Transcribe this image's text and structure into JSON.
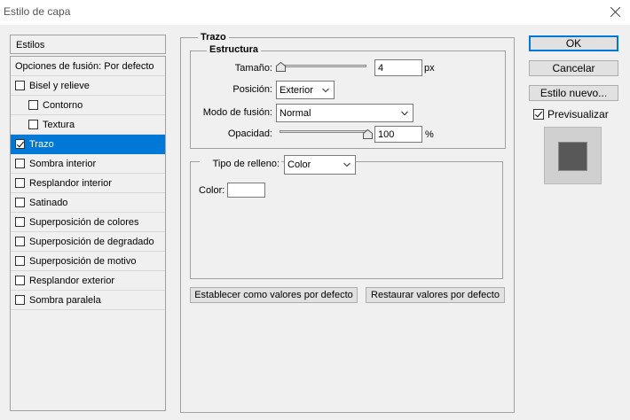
{
  "window": {
    "title": "Estilo de capa"
  },
  "sidebar": {
    "header": "Estilos",
    "items": [
      {
        "label": "Opciones de fusión: Por defecto",
        "checkbox": false,
        "checked": false,
        "indent": 0,
        "selected": false
      },
      {
        "label": "Bisel y relieve",
        "checkbox": true,
        "checked": false,
        "indent": 0,
        "selected": false
      },
      {
        "label": "Contorno",
        "checkbox": true,
        "checked": false,
        "indent": 1,
        "selected": false
      },
      {
        "label": "Textura",
        "checkbox": true,
        "checked": false,
        "indent": 1,
        "selected": false
      },
      {
        "label": "Trazo",
        "checkbox": true,
        "checked": true,
        "indent": 0,
        "selected": true
      },
      {
        "label": "Sombra interior",
        "checkbox": true,
        "checked": false,
        "indent": 0,
        "selected": false
      },
      {
        "label": "Resplandor interior",
        "checkbox": true,
        "checked": false,
        "indent": 0,
        "selected": false
      },
      {
        "label": "Satinado",
        "checkbox": true,
        "checked": false,
        "indent": 0,
        "selected": false
      },
      {
        "label": "Superposición de colores",
        "checkbox": true,
        "checked": false,
        "indent": 0,
        "selected": false
      },
      {
        "label": "Superposición de degradado",
        "checkbox": true,
        "checked": false,
        "indent": 0,
        "selected": false
      },
      {
        "label": "Superposición de motivo",
        "checkbox": true,
        "checked": false,
        "indent": 0,
        "selected": false
      },
      {
        "label": "Resplandor exterior",
        "checkbox": true,
        "checked": false,
        "indent": 0,
        "selected": false
      },
      {
        "label": "Sombra paralela",
        "checkbox": true,
        "checked": false,
        "indent": 0,
        "selected": false
      }
    ]
  },
  "stroke": {
    "section_title": "Trazo",
    "structure_title": "Estructura",
    "size_label": "Tamaño:",
    "size_value": "4",
    "size_unit": "px",
    "size_slider_fraction": 0.0,
    "position_label": "Posición:",
    "position_value": "Exterior",
    "blend_label": "Modo de fusión:",
    "blend_value": "Normal",
    "opacity_label": "Opacidad:",
    "opacity_value": "100",
    "opacity_unit": "%",
    "opacity_slider_fraction": 1.0,
    "fill_type_label": "Tipo de relleno:",
    "fill_type_value": "Color",
    "color_label": "Color:",
    "color_swatch": "#ffffff",
    "set_default_button": "Establecer como valores por defecto",
    "reset_default_button": "Restaurar valores por defecto"
  },
  "actions": {
    "ok": "OK",
    "cancel": "Cancelar",
    "new_style": "Estilo nuevo...",
    "preview_label": "Previsualizar",
    "preview_checked": true
  },
  "colors": {
    "selection": "#0078d7",
    "preview_swatch": "#585858"
  }
}
